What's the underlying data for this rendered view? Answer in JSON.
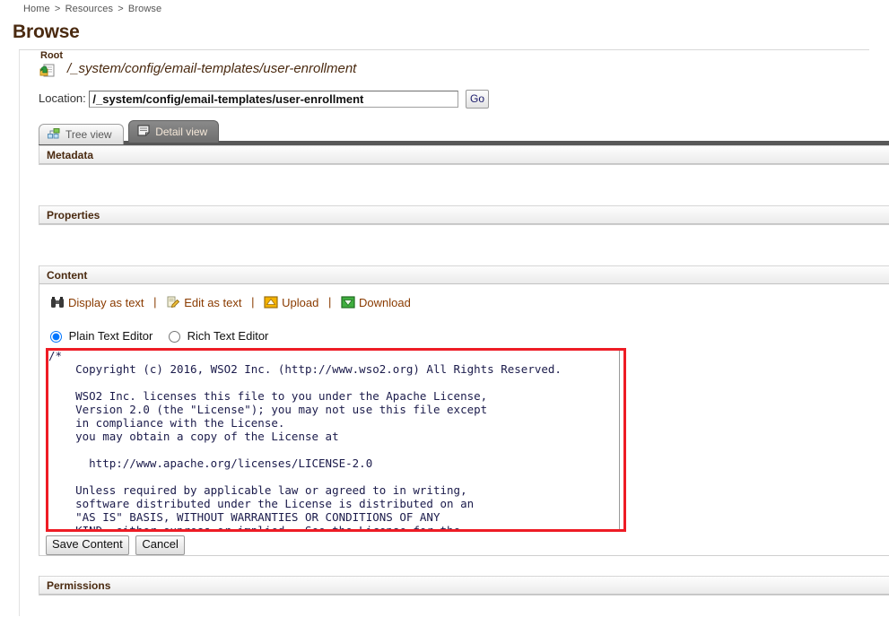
{
  "breadcrumb": {
    "items": [
      "Home",
      "Resources",
      "Browse"
    ],
    "separator": ">"
  },
  "page": {
    "title": "Browse"
  },
  "root": {
    "label": "Root",
    "icon": "folder-up-icon",
    "path": "/_system/config/email-templates/user-enrollment"
  },
  "location": {
    "label": "Location:",
    "value": "/_system/config/email-templates/user-enrollment",
    "placeholder": "",
    "go_label": "Go"
  },
  "tabs": [
    {
      "label": "Tree view",
      "icon": "tree-view-icon",
      "active": false
    },
    {
      "label": "Detail view",
      "icon": "detail-view-icon",
      "active": true
    }
  ],
  "sections": {
    "metadata": {
      "title": "Metadata"
    },
    "properties": {
      "title": "Properties"
    },
    "content": {
      "title": "Content"
    },
    "permissions": {
      "title": "Permissions"
    }
  },
  "content_toolbar": {
    "separator": "|",
    "links": [
      {
        "label": "Display as text",
        "icon": "binoculars-icon"
      },
      {
        "label": "Edit as text",
        "icon": "edit-pencil-icon"
      },
      {
        "label": "Upload",
        "icon": "upload-arrow-icon"
      },
      {
        "label": "Download",
        "icon": "download-arrow-icon"
      }
    ]
  },
  "editor_mode": {
    "plain_label": "Plain Text Editor",
    "rich_label": "Rich Text Editor",
    "selected": "plain"
  },
  "editor": {
    "content": "/*\n    Copyright (c) 2016, WSO2 Inc. (http://www.wso2.org) All Rights Reserved.\n\n    WSO2 Inc. licenses this file to you under the Apache License,\n    Version 2.0 (the \"License\"); you may not use this file except\n    in compliance with the License.\n    you may obtain a copy of the License at\n\n      http://www.apache.org/licenses/LICENSE-2.0\n\n    Unless required by applicable law or agreed to in writing,\n    software distributed under the License is distributed on an\n    \"AS IS\" BASIS, WITHOUT WARRANTIES OR CONDITIONS OF ANY\n    KIND, either express or implied.  See the License for the"
  },
  "form_actions": {
    "save_label": "Save Content",
    "cancel_label": "Cancel"
  },
  "colors": {
    "accent_brown": "#4a2a10",
    "link_orange": "#8a3b00",
    "annotation_red": "#ee1c25",
    "tab_active_bg": "#7a7a7a",
    "tab_bar": "#575757"
  }
}
